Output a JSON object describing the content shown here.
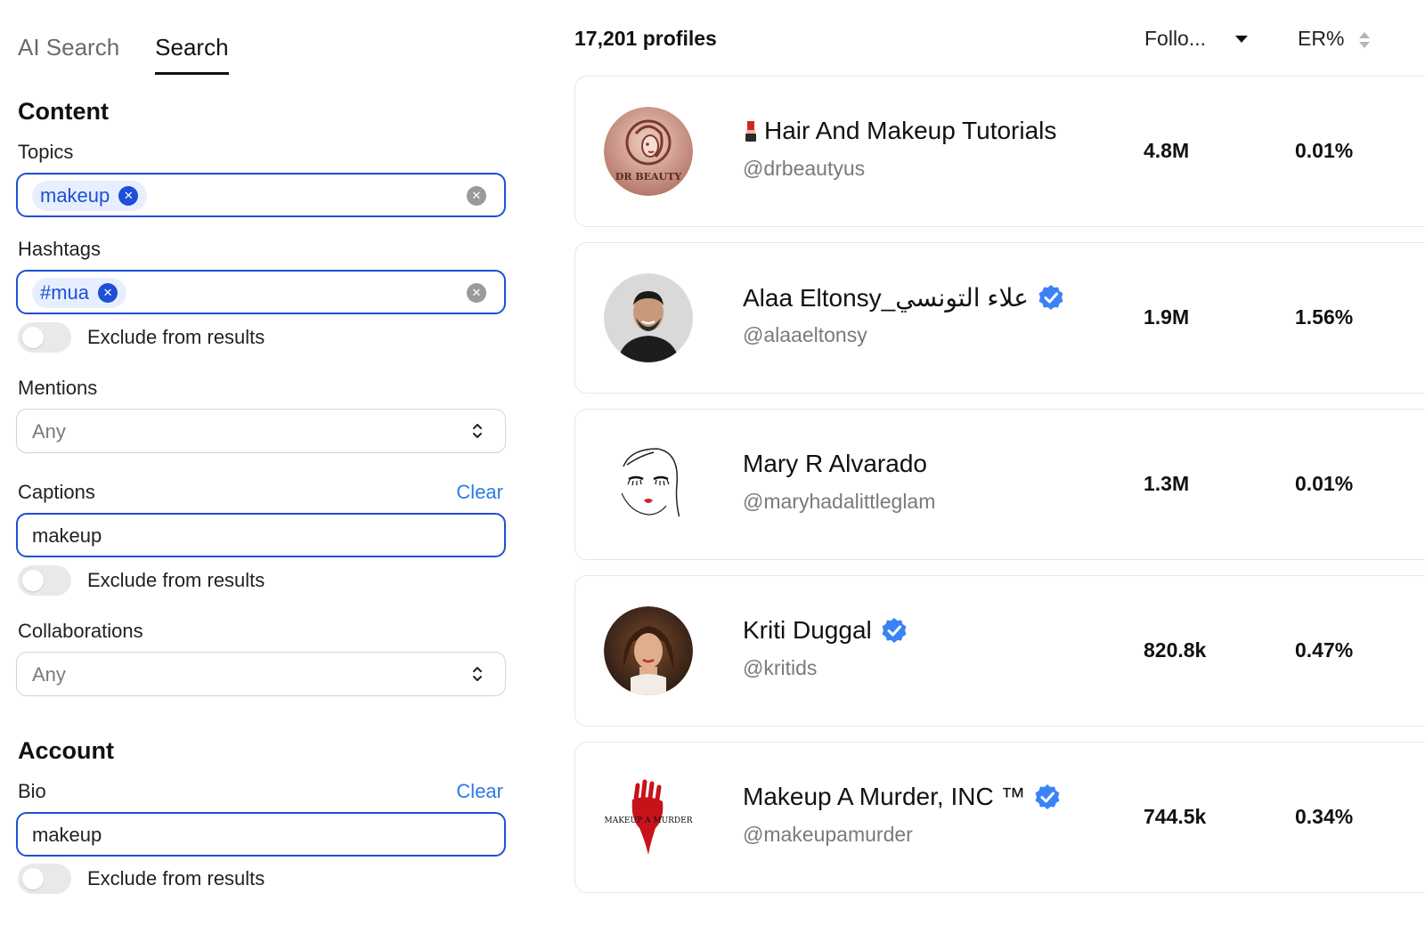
{
  "tabs": [
    {
      "label": "AI Search",
      "active": false
    },
    {
      "label": "Search",
      "active": true
    }
  ],
  "content_section": {
    "title": "Content",
    "topics": {
      "label": "Topics",
      "chips": [
        "makeup"
      ]
    },
    "hashtags": {
      "label": "Hashtags",
      "chips": [
        "#mua"
      ],
      "exclude_label": "Exclude from results",
      "exclude_on": false
    },
    "mentions": {
      "label": "Mentions",
      "value": "Any"
    },
    "captions": {
      "label": "Captions",
      "clear_label": "Clear",
      "value": "makeup",
      "exclude_label": "Exclude from results",
      "exclude_on": false
    },
    "collaborations": {
      "label": "Collaborations",
      "value": "Any"
    }
  },
  "account_section": {
    "title": "Account",
    "bio": {
      "label": "Bio",
      "clear_label": "Clear",
      "value": "makeup",
      "exclude_label": "Exclude from results",
      "exclude_on": false
    }
  },
  "results": {
    "count_label": "17,201 profiles",
    "sort_followers_label": "Follo...",
    "sort_er_label": "ER%",
    "profiles": [
      {
        "name": "Hair And Makeup Tutorials",
        "handle": "@drbeautyus",
        "followers": "4.8M",
        "er": "0.01%",
        "verified": false,
        "emoji": "lipstick-icon",
        "avatar_text": "DR BEAUTY"
      },
      {
        "name": "Alaa Eltonsy_علاء التونسي",
        "handle": "@alaaeltonsy",
        "followers": "1.9M",
        "er": "1.56%",
        "verified": true
      },
      {
        "name": "Mary R Alvarado",
        "handle": "@maryhadalittleglam",
        "followers": "1.3M",
        "er": "0.01%",
        "verified": false
      },
      {
        "name": "Kriti Duggal",
        "handle": "@kritids",
        "followers": "820.8k",
        "er": "0.47%",
        "verified": true
      },
      {
        "name": "Makeup A Murder, INC ™",
        "handle": "@makeupamurder",
        "followers": "744.5k",
        "er": "0.34%",
        "verified": true,
        "avatar_text": "MAKEUP A MURDER"
      }
    ]
  },
  "colors": {
    "accent": "#1d4fd8",
    "link": "#2c7be5",
    "chip_bg": "#e7efff",
    "verified": "#3b82f6"
  }
}
